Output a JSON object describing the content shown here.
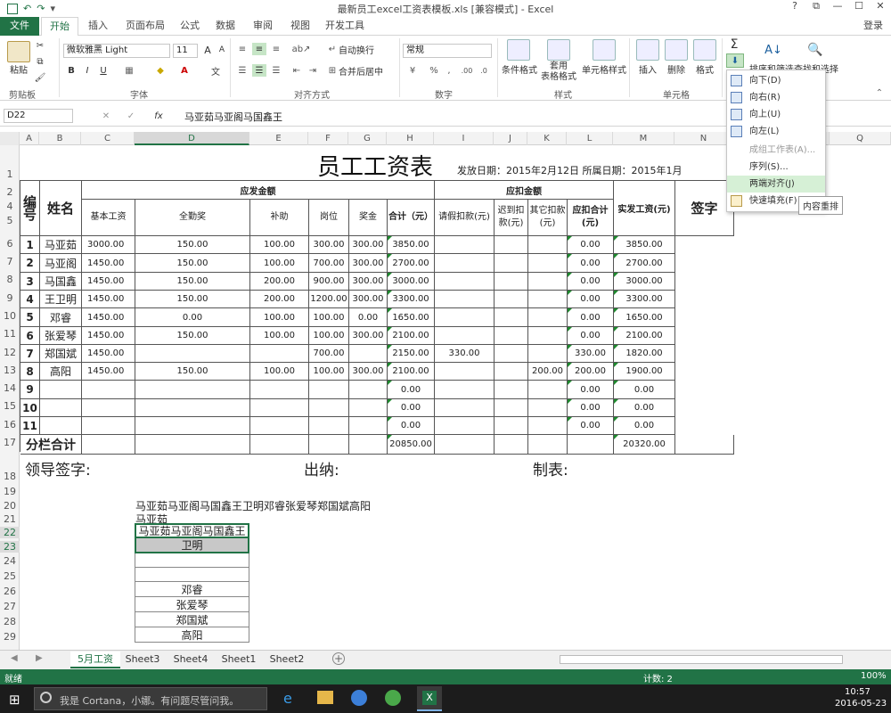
{
  "window": {
    "title": "最新员工excel工资表模板.xls [兼容模式] - Excel",
    "controls": [
      "?",
      "⧉",
      "—",
      "☐",
      "✕"
    ],
    "login_label": "登录"
  },
  "ribbon_tabs": [
    "文件",
    "开始",
    "插入",
    "页面布局",
    "公式",
    "数据",
    "审阅",
    "视图",
    "开发工具"
  ],
  "ribbon": {
    "clipboard": {
      "paste": "粘贴",
      "group": "剪贴板"
    },
    "font": {
      "name": "微软雅黑 Light",
      "size": "11",
      "group": "字体"
    },
    "alignment": {
      "wrap": "自动换行",
      "merge": "合并后居中",
      "group": "对齐方式"
    },
    "number": {
      "format": "常规",
      "group": "数字"
    },
    "styles": {
      "conditional": "条件格式",
      "table": "套用\n表格格式",
      "cell": "单元格样式",
      "group": "样式"
    },
    "cells": {
      "insert": "插入",
      "delete": "删除",
      "format": "格式",
      "group": "单元格"
    },
    "editing": {
      "sort": "排序和筛选",
      "find": "查找和选择"
    }
  },
  "fill_menu": {
    "items": [
      {
        "label": "向下(D)",
        "enabled": true
      },
      {
        "label": "向右(R)",
        "enabled": true
      },
      {
        "label": "向上(U)",
        "enabled": true
      },
      {
        "label": "向左(L)",
        "enabled": true
      },
      {
        "label": "成组工作表(A)...",
        "enabled": false
      },
      {
        "label": "序列(S)...",
        "enabled": true
      },
      {
        "label": "两端对齐(J)",
        "enabled": true,
        "highlighted": true
      },
      {
        "label": "快速填充(F)",
        "enabled": true
      }
    ],
    "tooltip": "内容重排"
  },
  "formula_bar": {
    "name_box": "D22",
    "fx": "fx",
    "content": "马亚茹马亚阁马国鑫王"
  },
  "columns": [
    "A",
    "B",
    "C",
    "D",
    "E",
    "F",
    "G",
    "H",
    "I",
    "J",
    "K",
    "L",
    "M",
    "N",
    "O",
    "P",
    "Q"
  ],
  "rows": [
    "1",
    "2",
    "4",
    "5",
    "6",
    "7",
    "8",
    "9",
    "10",
    "11",
    "12",
    "13",
    "14",
    "15",
    "16",
    "17",
    "18",
    "19",
    "20",
    "21",
    "22",
    "23",
    "24",
    "25",
    "26",
    "27",
    "28",
    "29"
  ],
  "sheet": {
    "title": "员工工资表",
    "issue_date": "发放日期：2015年2月12日 所属日期：2015年1月",
    "hdr_num": "编号",
    "hdr_name": "姓名",
    "hdr_payable": "应发金额",
    "hdr_deduct": "应扣金额",
    "hdr_net": "实发工资(元)",
    "hdr_sign": "签字",
    "sub": [
      "基本工资",
      "全勤奖",
      "补助",
      "岗位",
      "奖金",
      "合计（元）",
      "请假扣款(元)",
      "迟到扣款(元)",
      "其它扣款(元)",
      "应扣合计(元)"
    ],
    "employees": [
      {
        "no": "1",
        "name": "马亚茹",
        "base": "3000.00",
        "attend": "150.00",
        "allow": "100.00",
        "post": "300.00",
        "bonus": "300.00",
        "total": "3850.00",
        "leave": "",
        "late": "",
        "other": "",
        "dsum": "0.00",
        "net": "3850.00"
      },
      {
        "no": "2",
        "name": "马亚阁",
        "base": "1450.00",
        "attend": "150.00",
        "allow": "100.00",
        "post": "700.00",
        "bonus": "300.00",
        "total": "2700.00",
        "leave": "",
        "late": "",
        "other": "",
        "dsum": "0.00",
        "net": "2700.00"
      },
      {
        "no": "3",
        "name": "马国鑫",
        "base": "1450.00",
        "attend": "150.00",
        "allow": "200.00",
        "post": "900.00",
        "bonus": "300.00",
        "total": "3000.00",
        "leave": "",
        "late": "",
        "other": "",
        "dsum": "0.00",
        "net": "3000.00"
      },
      {
        "no": "4",
        "name": "王卫明",
        "base": "1450.00",
        "attend": "150.00",
        "allow": "200.00",
        "post": "1200.00",
        "bonus": "300.00",
        "total": "3300.00",
        "leave": "",
        "late": "",
        "other": "",
        "dsum": "0.00",
        "net": "3300.00"
      },
      {
        "no": "5",
        "name": "邓睿",
        "base": "1450.00",
        "attend": "0.00",
        "allow": "100.00",
        "post": "100.00",
        "bonus": "0.00",
        "total": "1650.00",
        "leave": "",
        "late": "",
        "other": "",
        "dsum": "0.00",
        "net": "1650.00"
      },
      {
        "no": "6",
        "name": "张爱琴",
        "base": "1450.00",
        "attend": "150.00",
        "allow": "100.00",
        "post": "100.00",
        "bonus": "300.00",
        "total": "2100.00",
        "leave": "",
        "late": "",
        "other": "",
        "dsum": "0.00",
        "net": "2100.00"
      },
      {
        "no": "7",
        "name": "郑国斌",
        "base": "1450.00",
        "attend": "",
        "allow": "",
        "post": "700.00",
        "bonus": "",
        "total": "2150.00",
        "leave": "330.00",
        "late": "",
        "other": "",
        "dsum": "330.00",
        "net": "1820.00"
      },
      {
        "no": "8",
        "name": "高阳",
        "base": "1450.00",
        "attend": "150.00",
        "allow": "100.00",
        "post": "100.00",
        "bonus": "300.00",
        "total": "2100.00",
        "leave": "",
        "late": "",
        "other": "200.00",
        "dsum": "200.00",
        "net": "1900.00"
      },
      {
        "no": "9",
        "name": "",
        "base": "",
        "attend": "",
        "allow": "",
        "post": "",
        "bonus": "",
        "total": "0.00",
        "leave": "",
        "late": "",
        "other": "",
        "dsum": "0.00",
        "net": "0.00"
      },
      {
        "no": "10",
        "name": "",
        "base": "",
        "attend": "",
        "allow": "",
        "post": "",
        "bonus": "",
        "total": "0.00",
        "leave": "",
        "late": "",
        "other": "",
        "dsum": "0.00",
        "net": "0.00"
      },
      {
        "no": "11",
        "name": "",
        "base": "",
        "attend": "",
        "allow": "",
        "post": "",
        "bonus": "",
        "total": "0.00",
        "leave": "",
        "late": "",
        "other": "",
        "dsum": "0.00",
        "net": "0.00"
      }
    ],
    "subtotal_label": "分栏合计",
    "subtotal_total": "20850.00",
    "subtotal_net": "20320.00",
    "leader_sign": "领导签字:",
    "cashier": "出纳:",
    "preparer": "制表:",
    "r20": "马亚茹马亚阁马国鑫王卫明邓睿张爱琴郑国斌高阳",
    "r21": "马亚茹",
    "list": [
      "马亚茹马亚阁马国鑫王",
      "卫明",
      "",
      "",
      "邓睿",
      "张爱琴",
      "郑国斌",
      "高阳"
    ]
  },
  "sheet_tabs": [
    "5月工资",
    "Sheet3",
    "Sheet4",
    "Sheet1",
    "Sheet2"
  ],
  "status": {
    "ready": "就绪",
    "count": "计数: 2",
    "zoom": "100%"
  },
  "taskbar": {
    "search": "我是 Cortana，小娜。有问题尽管问我。",
    "time": "10:57",
    "date": "2016-05-23"
  },
  "colors": {
    "excel_green": "#217346",
    "cell_tri": "#1e8a2e",
    "menu_highlight": "#d6f0d6"
  }
}
